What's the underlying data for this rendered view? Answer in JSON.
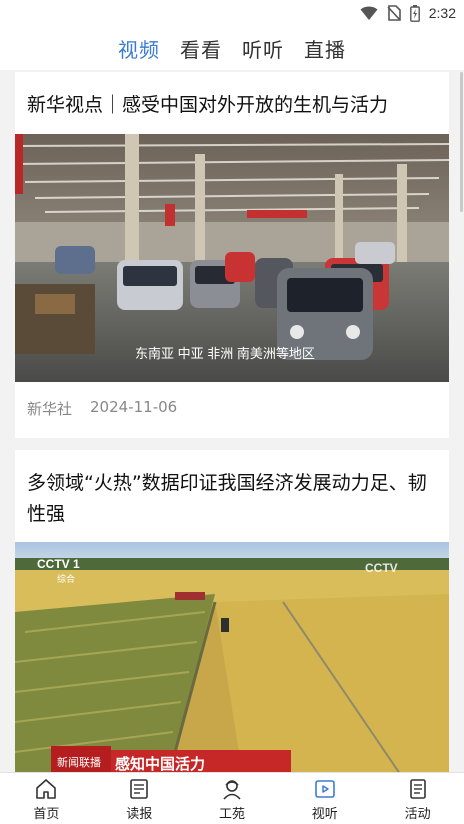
{
  "status_bar": {
    "time": "2:32",
    "icons": [
      "wifi-icon",
      "no-sim-icon",
      "battery-icon"
    ]
  },
  "top_tabs": [
    {
      "label": "视频",
      "active": true
    },
    {
      "label": "看看",
      "active": false
    },
    {
      "label": "听听",
      "active": false
    },
    {
      "label": "直播",
      "active": false
    }
  ],
  "feed": [
    {
      "title": "新华视点｜感受中国对外开放的生机与活力",
      "image_caption": "东南亚 中亚 非洲 南美洲等地区",
      "source": "新华社",
      "date": "2024-11-06"
    },
    {
      "title": "多领域“火热”数据印证我国经济发展动力足、韧性强",
      "image_logo_left": "CCTV 1",
      "image_logo_left_sub": "综合",
      "image_logo_right": "CCTV",
      "image_banner": "感知中国活力",
      "image_banner_tag": "新闻联播"
    }
  ],
  "bottom_nav": [
    {
      "label": "首页",
      "icon": "home-icon",
      "active": false
    },
    {
      "label": "读报",
      "icon": "newspaper-icon",
      "active": false
    },
    {
      "label": "工苑",
      "icon": "worker-icon",
      "active": false
    },
    {
      "label": "视听",
      "icon": "video-play-icon",
      "active": true
    },
    {
      "label": "活动",
      "icon": "activity-list-icon",
      "active": false
    }
  ],
  "colors": {
    "accent": "#3a7bd5",
    "background": "#f2f2f2",
    "card": "#ffffff",
    "meta_text": "#888888"
  }
}
